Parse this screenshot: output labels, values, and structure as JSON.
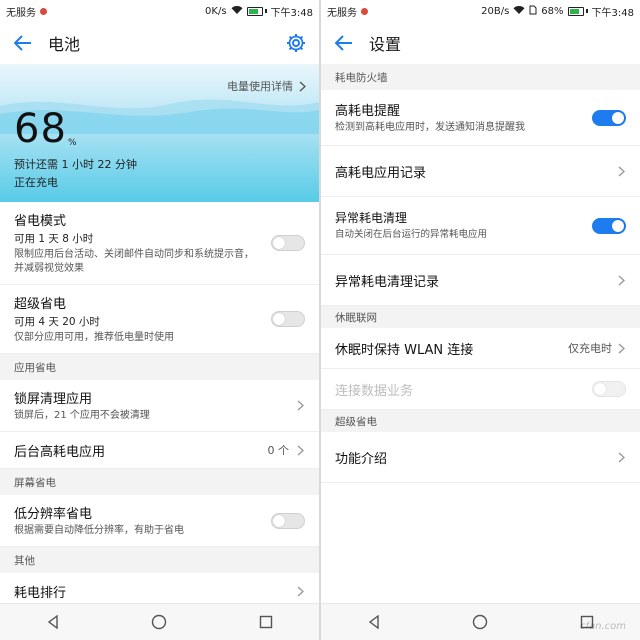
{
  "left": {
    "status": {
      "carrier": "无服务",
      "net": "0K/s",
      "time": "下午3:48"
    },
    "title": "电池",
    "usage_link": "电量使用详情",
    "battery": {
      "percent": "68",
      "unit": "%",
      "remaining": "预计还需 1 小时 22 分钟",
      "state": "正在充电"
    },
    "items": {
      "saver": {
        "title": "省电模式",
        "strong": "可用 1 天 8 小时",
        "desc": "限制应用后台活动、关闭邮件自动同步和系统提示音，并减弱视觉效果"
      },
      "super": {
        "title": "超级省电",
        "strong": "可用 4 天 20 小时",
        "desc": "仅部分应用可用，推荐低电量时使用"
      },
      "sec_app": "应用省电",
      "lockclean": {
        "title": "锁屏清理应用",
        "desc": "锁屏后，21 个应用不会被清理"
      },
      "highbg": {
        "title": "后台高耗电应用",
        "value": "0 个"
      },
      "sec_screen": "屏幕省电",
      "lowres": {
        "title": "低分辨率省电",
        "desc": "根据需要自动降低分辨率，有助于省电"
      },
      "sec_other": "其他",
      "rank": {
        "title": "耗电排行"
      }
    }
  },
  "right": {
    "status": {
      "carrier": "无服务",
      "net": "20B/s",
      "battery": "68%",
      "time": "下午3:48"
    },
    "title": "设置",
    "sec_firewall": "耗电防火墙",
    "high_alert": {
      "title": "高耗电提醒",
      "desc": "检测到高耗电应用时，发送通知消息提醒我"
    },
    "high_record": "高耗电应用记录",
    "abn_clean": {
      "title": "异常耗电清理",
      "desc": "自动关闭在后台运行的异常耗电应用"
    },
    "abn_record": "异常耗电清理记录",
    "sec_sleep": "休眠联网",
    "wlan": {
      "title": "休眠时保持 WLAN 连接",
      "value": "仅充电时"
    },
    "mobile_data": "连接数据业务",
    "sec_super": "超级省电",
    "feature": "功能介绍",
    "watermark": "cfan.com"
  },
  "colors": {
    "accent": "#1f7cf0",
    "banner": "#58cbe8"
  },
  "battery_level": 0.68
}
